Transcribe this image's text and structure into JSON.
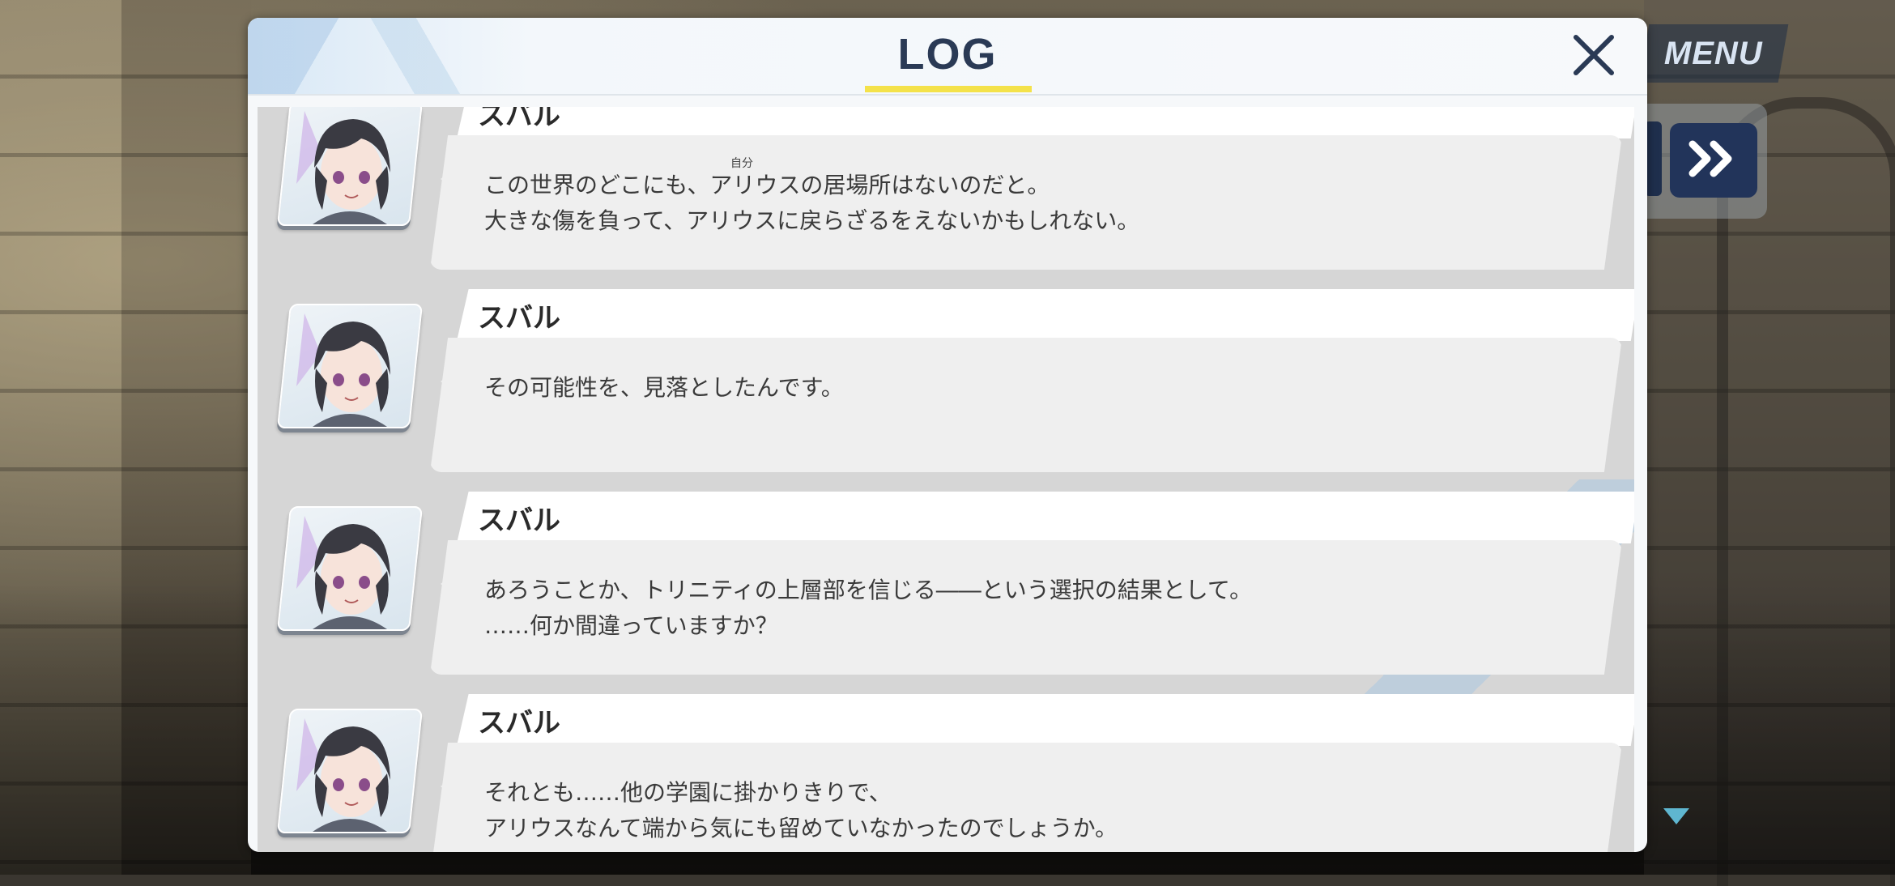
{
  "header": {
    "title": "LOG",
    "close_icon": "close-icon"
  },
  "game_ui": {
    "menu_label": "MENU",
    "skip_icon": "fast-forward-icon",
    "scroll_indicator_icon": "triangle-down-icon"
  },
  "colors": {
    "title_underline": "#f4e24a",
    "title_text": "#2a3a55",
    "skip_button": "#22345a",
    "entry_text_bg": "#efefef"
  },
  "entries": [
    {
      "speaker": "スバル",
      "ruby": "自分",
      "lines": [
        "この世界のどこにも、アリウスの居場所はないのだと。",
        "大きな傷を負って、アリウスに戻らざるをえないかもしれない。"
      ]
    },
    {
      "speaker": "スバル",
      "lines": [
        "その可能性を、見落としたんです。"
      ]
    },
    {
      "speaker": "スバル",
      "lines": [
        "あろうことか、トリニティの上層部を信じる――という選択の結果として。",
        "……何か間違っていますか？"
      ]
    },
    {
      "speaker": "スバル",
      "lines": [
        "それとも……他の学園に掛かりきりで、",
        "アリウスなんて端から気にも留めていなかったのでしょうか。"
      ]
    }
  ]
}
